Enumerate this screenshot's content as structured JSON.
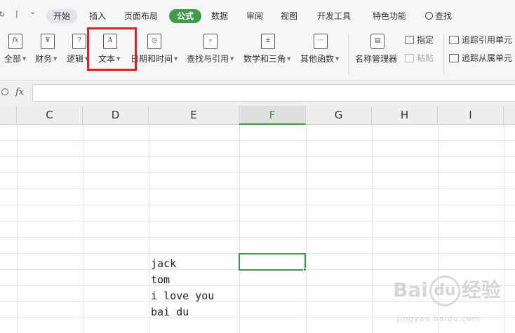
{
  "menubar": {
    "redo_glyph": "↻",
    "dropdown_glyph": "⌄",
    "tabs": [
      "开始",
      "插入",
      "页面布局",
      "公式",
      "数据",
      "审阅",
      "视图",
      "开发工具",
      "特色功能"
    ],
    "search_label": "查找",
    "active_tab": "公式"
  },
  "ribbon": {
    "buttons": [
      {
        "label": "全部",
        "icon": "fx",
        "icon_name": "function-icon"
      },
      {
        "label": "财务",
        "icon": "¥",
        "icon_name": "finance-icon"
      },
      {
        "label": "逻辑",
        "icon": "?",
        "icon_name": "logic-icon"
      },
      {
        "label": "文本",
        "icon": "A",
        "icon_name": "text-icon"
      },
      {
        "label": "日期和时间",
        "icon": "◷",
        "icon_name": "clock-icon"
      },
      {
        "label": "查找与引用",
        "icon": "⌕",
        "icon_name": "lookup-icon"
      },
      {
        "label": "数学和三角",
        "icon": "±",
        "icon_name": "math-icon"
      },
      {
        "label": "其他函数",
        "icon": "···",
        "icon_name": "more-functions-icon"
      }
    ],
    "name_manager_label": "名称管理器",
    "assign_label": "指定",
    "paste_label": "粘贴",
    "trace_precedents_label": "追踪引用单元",
    "trace_dependents_label": "追踪从属单元"
  },
  "formula_bar": {
    "zoom_glyph": "🔍",
    "fx_label": "fx",
    "value": ""
  },
  "grid": {
    "columns": [
      "C",
      "D",
      "E",
      "F",
      "G",
      "H",
      "I"
    ],
    "selected_column": "F",
    "cells": [
      "jack",
      "tom",
      "i love you",
      "bai du"
    ]
  },
  "watermark": {
    "text_left": "Bai",
    "text_paw": "du",
    "text_right": "经验",
    "sub": "jingyan.baidu.com"
  },
  "colors": {
    "accent_green": "#3d9b4a",
    "highlight_red": "#e0201c"
  }
}
